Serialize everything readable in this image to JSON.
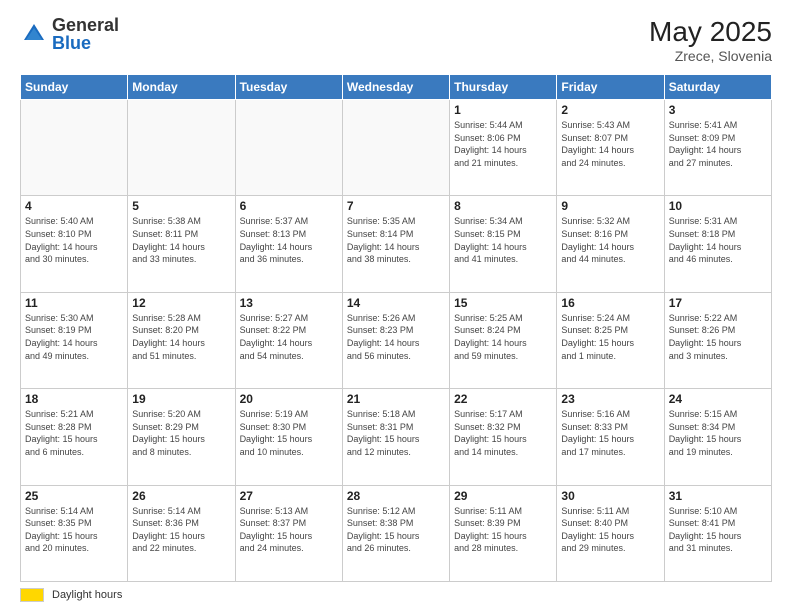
{
  "header": {
    "logo_general": "General",
    "logo_blue": "Blue",
    "month_year": "May 2025",
    "location": "Zrece, Slovenia"
  },
  "days_of_week": [
    "Sunday",
    "Monday",
    "Tuesday",
    "Wednesday",
    "Thursday",
    "Friday",
    "Saturday"
  ],
  "footer": {
    "daylight_label": "Daylight hours"
  },
  "weeks": [
    [
      {
        "day": "",
        "info": ""
      },
      {
        "day": "",
        "info": ""
      },
      {
        "day": "",
        "info": ""
      },
      {
        "day": "",
        "info": ""
      },
      {
        "day": "1",
        "info": "Sunrise: 5:44 AM\nSunset: 8:06 PM\nDaylight: 14 hours\nand 21 minutes."
      },
      {
        "day": "2",
        "info": "Sunrise: 5:43 AM\nSunset: 8:07 PM\nDaylight: 14 hours\nand 24 minutes."
      },
      {
        "day": "3",
        "info": "Sunrise: 5:41 AM\nSunset: 8:09 PM\nDaylight: 14 hours\nand 27 minutes."
      }
    ],
    [
      {
        "day": "4",
        "info": "Sunrise: 5:40 AM\nSunset: 8:10 PM\nDaylight: 14 hours\nand 30 minutes."
      },
      {
        "day": "5",
        "info": "Sunrise: 5:38 AM\nSunset: 8:11 PM\nDaylight: 14 hours\nand 33 minutes."
      },
      {
        "day": "6",
        "info": "Sunrise: 5:37 AM\nSunset: 8:13 PM\nDaylight: 14 hours\nand 36 minutes."
      },
      {
        "day": "7",
        "info": "Sunrise: 5:35 AM\nSunset: 8:14 PM\nDaylight: 14 hours\nand 38 minutes."
      },
      {
        "day": "8",
        "info": "Sunrise: 5:34 AM\nSunset: 8:15 PM\nDaylight: 14 hours\nand 41 minutes."
      },
      {
        "day": "9",
        "info": "Sunrise: 5:32 AM\nSunset: 8:16 PM\nDaylight: 14 hours\nand 44 minutes."
      },
      {
        "day": "10",
        "info": "Sunrise: 5:31 AM\nSunset: 8:18 PM\nDaylight: 14 hours\nand 46 minutes."
      }
    ],
    [
      {
        "day": "11",
        "info": "Sunrise: 5:30 AM\nSunset: 8:19 PM\nDaylight: 14 hours\nand 49 minutes."
      },
      {
        "day": "12",
        "info": "Sunrise: 5:28 AM\nSunset: 8:20 PM\nDaylight: 14 hours\nand 51 minutes."
      },
      {
        "day": "13",
        "info": "Sunrise: 5:27 AM\nSunset: 8:22 PM\nDaylight: 14 hours\nand 54 minutes."
      },
      {
        "day": "14",
        "info": "Sunrise: 5:26 AM\nSunset: 8:23 PM\nDaylight: 14 hours\nand 56 minutes."
      },
      {
        "day": "15",
        "info": "Sunrise: 5:25 AM\nSunset: 8:24 PM\nDaylight: 14 hours\nand 59 minutes."
      },
      {
        "day": "16",
        "info": "Sunrise: 5:24 AM\nSunset: 8:25 PM\nDaylight: 15 hours\nand 1 minute."
      },
      {
        "day": "17",
        "info": "Sunrise: 5:22 AM\nSunset: 8:26 PM\nDaylight: 15 hours\nand 3 minutes."
      }
    ],
    [
      {
        "day": "18",
        "info": "Sunrise: 5:21 AM\nSunset: 8:28 PM\nDaylight: 15 hours\nand 6 minutes."
      },
      {
        "day": "19",
        "info": "Sunrise: 5:20 AM\nSunset: 8:29 PM\nDaylight: 15 hours\nand 8 minutes."
      },
      {
        "day": "20",
        "info": "Sunrise: 5:19 AM\nSunset: 8:30 PM\nDaylight: 15 hours\nand 10 minutes."
      },
      {
        "day": "21",
        "info": "Sunrise: 5:18 AM\nSunset: 8:31 PM\nDaylight: 15 hours\nand 12 minutes."
      },
      {
        "day": "22",
        "info": "Sunrise: 5:17 AM\nSunset: 8:32 PM\nDaylight: 15 hours\nand 14 minutes."
      },
      {
        "day": "23",
        "info": "Sunrise: 5:16 AM\nSunset: 8:33 PM\nDaylight: 15 hours\nand 17 minutes."
      },
      {
        "day": "24",
        "info": "Sunrise: 5:15 AM\nSunset: 8:34 PM\nDaylight: 15 hours\nand 19 minutes."
      }
    ],
    [
      {
        "day": "25",
        "info": "Sunrise: 5:14 AM\nSunset: 8:35 PM\nDaylight: 15 hours\nand 20 minutes."
      },
      {
        "day": "26",
        "info": "Sunrise: 5:14 AM\nSunset: 8:36 PM\nDaylight: 15 hours\nand 22 minutes."
      },
      {
        "day": "27",
        "info": "Sunrise: 5:13 AM\nSunset: 8:37 PM\nDaylight: 15 hours\nand 24 minutes."
      },
      {
        "day": "28",
        "info": "Sunrise: 5:12 AM\nSunset: 8:38 PM\nDaylight: 15 hours\nand 26 minutes."
      },
      {
        "day": "29",
        "info": "Sunrise: 5:11 AM\nSunset: 8:39 PM\nDaylight: 15 hours\nand 28 minutes."
      },
      {
        "day": "30",
        "info": "Sunrise: 5:11 AM\nSunset: 8:40 PM\nDaylight: 15 hours\nand 29 minutes."
      },
      {
        "day": "31",
        "info": "Sunrise: 5:10 AM\nSunset: 8:41 PM\nDaylight: 15 hours\nand 31 minutes."
      }
    ]
  ]
}
